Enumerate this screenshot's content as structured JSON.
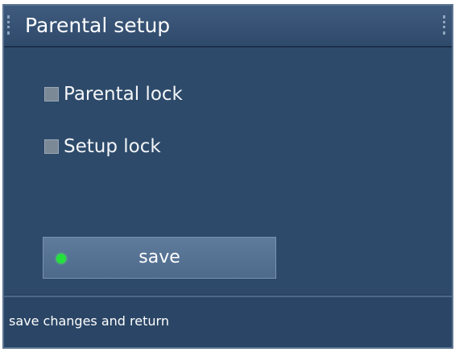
{
  "window": {
    "title": "Parental setup"
  },
  "options": [
    {
      "label": "Parental lock",
      "checked": false
    },
    {
      "label": "Setup lock",
      "checked": false
    }
  ],
  "save_button": {
    "label": "save",
    "indicator_color": "#25e03c"
  },
  "help_bar": {
    "text": "save changes and return"
  },
  "colors": {
    "background": "#2b4564",
    "button": "#5a7697",
    "accent": "#25e03c"
  }
}
